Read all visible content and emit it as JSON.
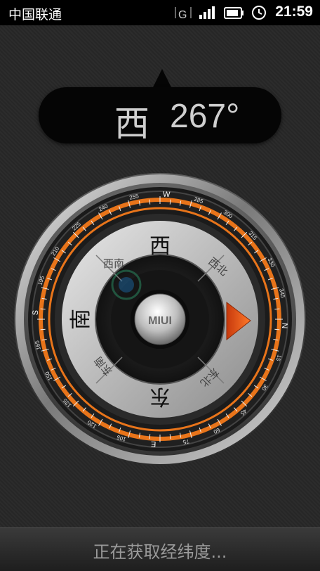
{
  "status_bar": {
    "carrier": "中国联通",
    "network_type": "G",
    "time": "21:59"
  },
  "heading": {
    "direction": "西",
    "degrees": "267°"
  },
  "compass": {
    "center_logo": "MIUI",
    "cardinal_labels": {
      "top": "西",
      "left": "南",
      "bottom": "东",
      "top_left": "西南",
      "top_right": "西北",
      "bottom_left": "东南",
      "bottom_right": "东北"
    },
    "bezel_letters": [
      "W",
      "N",
      "E",
      "S"
    ],
    "bezel_degree_labels": [
      "255",
      "285",
      "300",
      "315",
      "330",
      "345",
      "15",
      "30",
      "45",
      "60",
      "75",
      "105",
      "120",
      "135",
      "150",
      "165",
      "195",
      "210",
      "225",
      "240"
    ],
    "pointer_color": "#e8541a",
    "ring_color": "#e8741a"
  },
  "bottom_bar": {
    "message": "正在获取经纬度..."
  }
}
